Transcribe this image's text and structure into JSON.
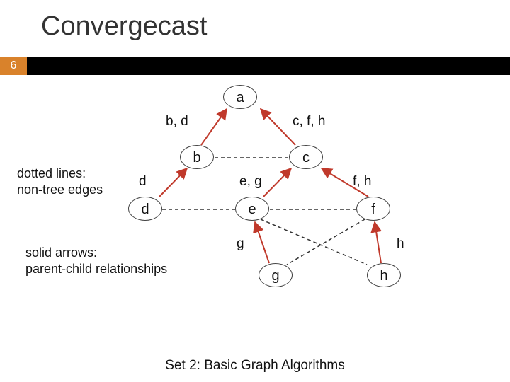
{
  "title": "Convergecast",
  "slide_number": "6",
  "footer": "Set 2:  Basic Graph Algorithms",
  "legend": {
    "dotted": "dotted lines:\nnon-tree edges",
    "solid": "solid arrows:\nparent-child relationships"
  },
  "nodes": {
    "a": "a",
    "b": "b",
    "c": "c",
    "d": "d",
    "e": "e",
    "f": "f",
    "g": "g",
    "h": "h"
  },
  "edge_labels": {
    "ab": "b, d",
    "ac": "c, f, h",
    "bd": "d",
    "ce": "e, g",
    "cf": "f, h",
    "eg": "g",
    "fh": "h"
  }
}
